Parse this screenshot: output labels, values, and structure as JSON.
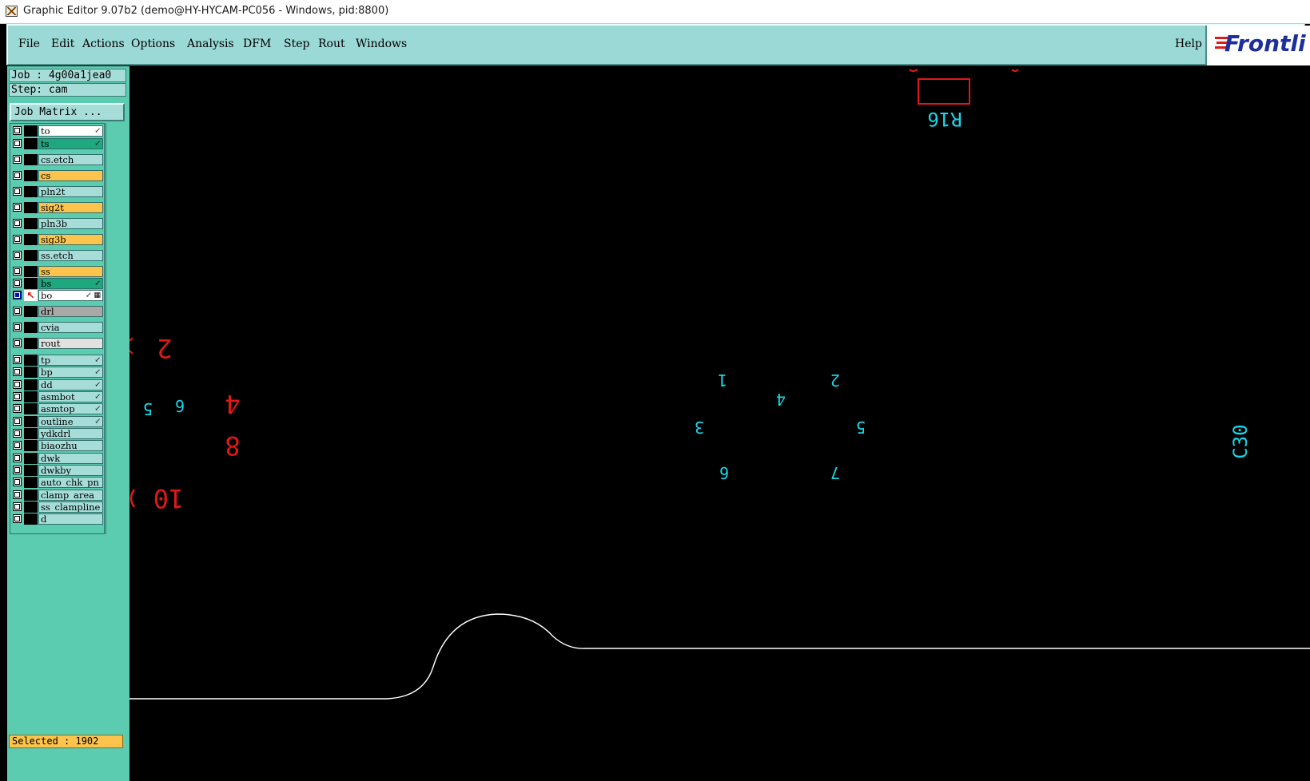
{
  "window": {
    "title": "Graphic Editor 9.07b2 (demo@HY-HYCAM-PC056 - Windows, pid:8800)"
  },
  "menubar": {
    "items": [
      {
        "label": "File"
      },
      {
        "label": "Edit"
      },
      {
        "label": "Actions"
      },
      {
        "label": "Options"
      },
      {
        "label": "Analysis"
      },
      {
        "label": "DFM"
      },
      {
        "label": "Step"
      },
      {
        "label": "Rout"
      },
      {
        "label": "Windows"
      }
    ],
    "help_label": "Help",
    "logo_text": "Frontli"
  },
  "panel": {
    "job": "Job : 4g00a1jea0",
    "step": "Step: cam",
    "job_matrix_label": "Job Matrix ...",
    "selected": "Selected : 1902"
  },
  "layers": [
    {
      "name": "to",
      "color": "#ffffff",
      "mark": "arrow"
    },
    {
      "name": "ts",
      "color": "#1ea87e",
      "mark": "arrow"
    },
    {
      "name": "cs.etch",
      "color": "#a6ddd8"
    },
    {
      "name": "cs",
      "color": "#fcc44c"
    },
    {
      "name": "pln2t",
      "color": "#a6ddd8"
    },
    {
      "name": "sig2t",
      "color": "#fcc44c"
    },
    {
      "name": "pln3b",
      "color": "#a6ddd8"
    },
    {
      "name": "sig3b",
      "color": "#fcc44c"
    },
    {
      "name": "ss.etch",
      "color": "#a6ddd8"
    },
    {
      "name": "ss",
      "color": "#fcc44c"
    },
    {
      "name": "bs",
      "color": "#1ea87e",
      "mark": "arrow"
    },
    {
      "name": "bo",
      "color": "#ffffff",
      "mark": "arrow-grid",
      "active": true
    },
    {
      "name": "drl",
      "color": "#a8a8a8"
    },
    {
      "name": "cvia",
      "color": "#a6ddd8"
    },
    {
      "name": "rout",
      "color": "#e2e2e2"
    },
    {
      "name": "tp",
      "color": "#a6ddd8",
      "mark": "arrow"
    },
    {
      "name": "bp",
      "color": "#a6ddd8",
      "mark": "arrow"
    },
    {
      "name": "dd",
      "color": "#a6ddd8",
      "mark": "arrow"
    },
    {
      "name": "asmbot",
      "color": "#a6ddd8",
      "mark": "arrow"
    },
    {
      "name": "asmtop",
      "color": "#a6ddd8",
      "mark": "arrow"
    },
    {
      "name": "outline",
      "color": "#a6ddd8",
      "mark": "arrow"
    },
    {
      "name": "ydkdrl",
      "color": "#a6ddd8"
    },
    {
      "name": "biaozhu",
      "color": "#a6ddd8"
    },
    {
      "name": "dwk",
      "color": "#a6ddd8"
    },
    {
      "name": "dwkby",
      "color": "#a6ddd8"
    },
    {
      "name": "auto_chk_pn",
      "color": "#a6ddd8"
    },
    {
      "name": "clamp_area",
      "color": "#a6ddd8"
    },
    {
      "name": "ss_clampline",
      "color": "#a6ddd8"
    },
    {
      "name": "d",
      "color": "#a6ddd8"
    }
  ],
  "canvas_labels": {
    "r16": "R16",
    "c30": "C30",
    "cyan_pins": [
      "1",
      "2",
      "4",
      "3",
      "5",
      "6",
      "7"
    ],
    "left_cyan": [
      "5",
      "6"
    ],
    "red_nums": [
      "2",
      "4",
      "8",
      "10"
    ]
  },
  "colors": {
    "menubar": "#9ad9d6",
    "panel": "#5cccb0",
    "canvas": "#000000",
    "cyan_text": "#19d6e6",
    "red_text": "#e01818",
    "outline": "#ffffff",
    "selected_status": "#fcc44c"
  }
}
